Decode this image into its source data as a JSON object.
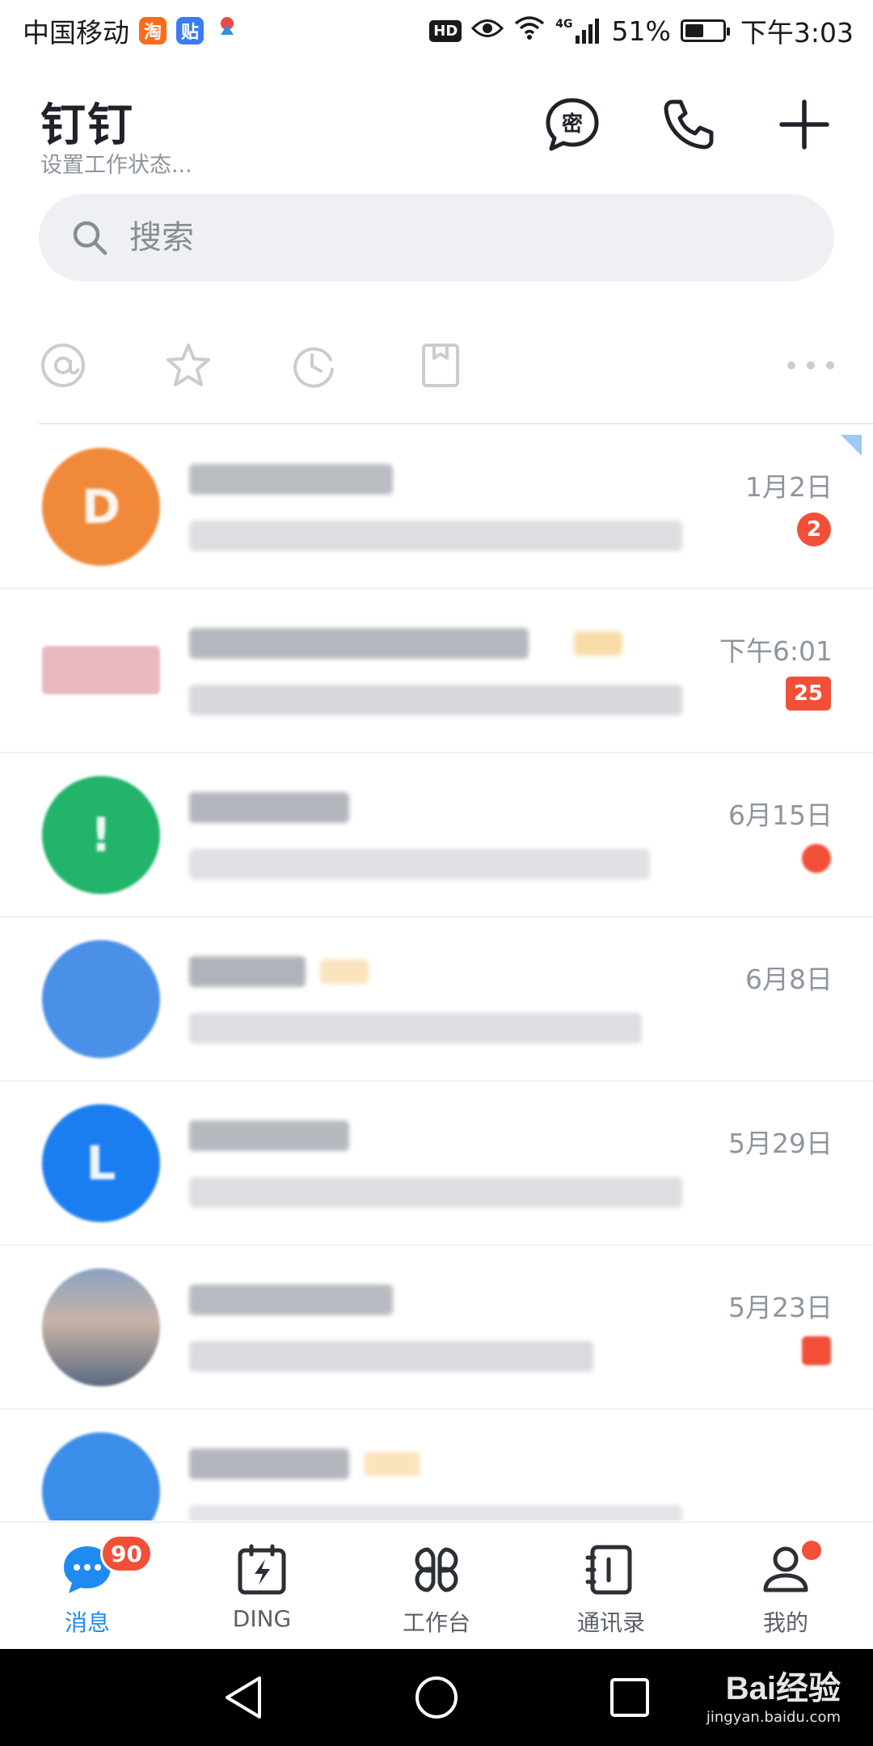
{
  "status_bar": {
    "carrier": "中国移动",
    "apps": [
      {
        "icon": "taobao-app-icon",
        "label": "淘",
        "color": "#ff6a1a"
      },
      {
        "icon": "tieba-app-icon",
        "label": "贴",
        "color": "#3b7cf5"
      }
    ],
    "hd": "HD",
    "network": "4G",
    "battery": "51%",
    "battery_level": 0.51,
    "time": "下午3:03"
  },
  "header": {
    "title": "钉钉",
    "subtitle": "设置工作状态...",
    "secret_chat_glyph": "密"
  },
  "search": {
    "placeholder": "搜索"
  },
  "filters": [
    "at-mention-icon",
    "star-icon",
    "clock-icon",
    "todo-icon",
    "more-icon"
  ],
  "conversations": [
    {
      "time": "1月2日",
      "unread": "2",
      "avatar_color": "#f08a3a",
      "avatar_glyph": "D"
    },
    {
      "time": "下午6:01",
      "unread": "25",
      "avatar_color": "#e9b9c2",
      "avatar_glyph": ""
    },
    {
      "time": "6月15日",
      "unread": "",
      "unread_dot": true,
      "avatar_color": "#22b46b",
      "avatar_glyph": "!"
    },
    {
      "time": "6月8日",
      "unread": "",
      "avatar_color": "#4a90e6",
      "avatar_glyph": ""
    },
    {
      "time": "5月29日",
      "unread": "",
      "avatar_color": "#1b7ef0",
      "avatar_glyph": "L"
    },
    {
      "time": "5月23日",
      "unread": "",
      "unread_dot": true,
      "avatar_color": "#7f9bbd",
      "avatar_glyph": ""
    },
    {
      "time": "",
      "unread": "",
      "avatar_color": "#3a8de8",
      "avatar_glyph": ""
    }
  ],
  "tabs": [
    {
      "label": "消息",
      "icon": "message-icon",
      "badge": "90",
      "active": true
    },
    {
      "label": "DING",
      "icon": "ding-icon"
    },
    {
      "label": "工作台",
      "icon": "workbench-icon"
    },
    {
      "label": "通讯录",
      "icon": "contacts-icon"
    },
    {
      "label": "我的",
      "icon": "profile-icon",
      "dot": true
    }
  ],
  "watermark": {
    "main": "Bai经验",
    "sub": "jingyan.baidu.com"
  },
  "colors": {
    "accent": "#1f8bf2",
    "badge": "#f24f38",
    "secondary_text": "#8f959e"
  }
}
